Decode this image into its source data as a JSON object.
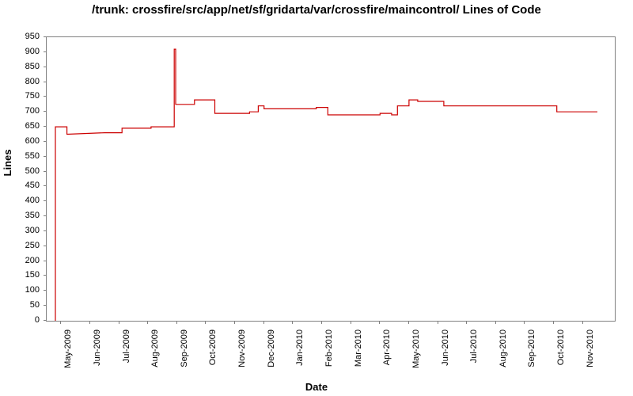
{
  "chart_data": {
    "type": "line",
    "title": "/trunk: crossfire/src/app/net/sf/gridarta/var/crossfire/maincontrol/ Lines of Code",
    "xlabel": "Date",
    "ylabel": "Lines",
    "ylim": [
      0,
      950
    ],
    "y_ticks": [
      0,
      50,
      100,
      150,
      200,
      250,
      300,
      350,
      400,
      450,
      500,
      550,
      600,
      650,
      700,
      750,
      800,
      850,
      900,
      950
    ],
    "x_categories": [
      "May-2009",
      "Jun-2009",
      "Jul-2009",
      "Aug-2009",
      "Sep-2009",
      "Oct-2009",
      "Nov-2009",
      "Dec-2009",
      "Jan-2010",
      "Feb-2010",
      "Mar-2010",
      "Apr-2010",
      "May-2010",
      "Jun-2010",
      "Jul-2010",
      "Aug-2010",
      "Sep-2010",
      "Oct-2010",
      "Nov-2010"
    ],
    "x_range_months": 19.6,
    "series": [
      {
        "name": "Lines of Code",
        "color": "#cc0000",
        "points": [
          {
            "x": 0.3,
            "y": 0
          },
          {
            "x": 0.3,
            "y": 650
          },
          {
            "x": 0.7,
            "y": 650
          },
          {
            "x": 0.7,
            "y": 625
          },
          {
            "x": 2.0,
            "y": 630
          },
          {
            "x": 2.6,
            "y": 630
          },
          {
            "x": 2.6,
            "y": 645
          },
          {
            "x": 3.6,
            "y": 645
          },
          {
            "x": 3.6,
            "y": 650
          },
          {
            "x": 4.4,
            "y": 650
          },
          {
            "x": 4.4,
            "y": 910
          },
          {
            "x": 4.45,
            "y": 910
          },
          {
            "x": 4.45,
            "y": 725
          },
          {
            "x": 5.1,
            "y": 725
          },
          {
            "x": 5.1,
            "y": 740
          },
          {
            "x": 5.8,
            "y": 740
          },
          {
            "x": 5.8,
            "y": 695
          },
          {
            "x": 7.0,
            "y": 695
          },
          {
            "x": 7.0,
            "y": 700
          },
          {
            "x": 7.3,
            "y": 700
          },
          {
            "x": 7.3,
            "y": 720
          },
          {
            "x": 7.5,
            "y": 720
          },
          {
            "x": 7.5,
            "y": 710
          },
          {
            "x": 9.3,
            "y": 710
          },
          {
            "x": 9.3,
            "y": 715
          },
          {
            "x": 9.7,
            "y": 715
          },
          {
            "x": 9.7,
            "y": 690
          },
          {
            "x": 11.5,
            "y": 690
          },
          {
            "x": 11.5,
            "y": 695
          },
          {
            "x": 11.9,
            "y": 695
          },
          {
            "x": 11.9,
            "y": 690
          },
          {
            "x": 12.1,
            "y": 690
          },
          {
            "x": 12.1,
            "y": 720
          },
          {
            "x": 12.5,
            "y": 720
          },
          {
            "x": 12.5,
            "y": 740
          },
          {
            "x": 12.8,
            "y": 740
          },
          {
            "x": 12.8,
            "y": 735
          },
          {
            "x": 13.7,
            "y": 735
          },
          {
            "x": 13.7,
            "y": 720
          },
          {
            "x": 17.6,
            "y": 720
          },
          {
            "x": 17.6,
            "y": 700
          },
          {
            "x": 19.0,
            "y": 700
          }
        ]
      }
    ]
  }
}
